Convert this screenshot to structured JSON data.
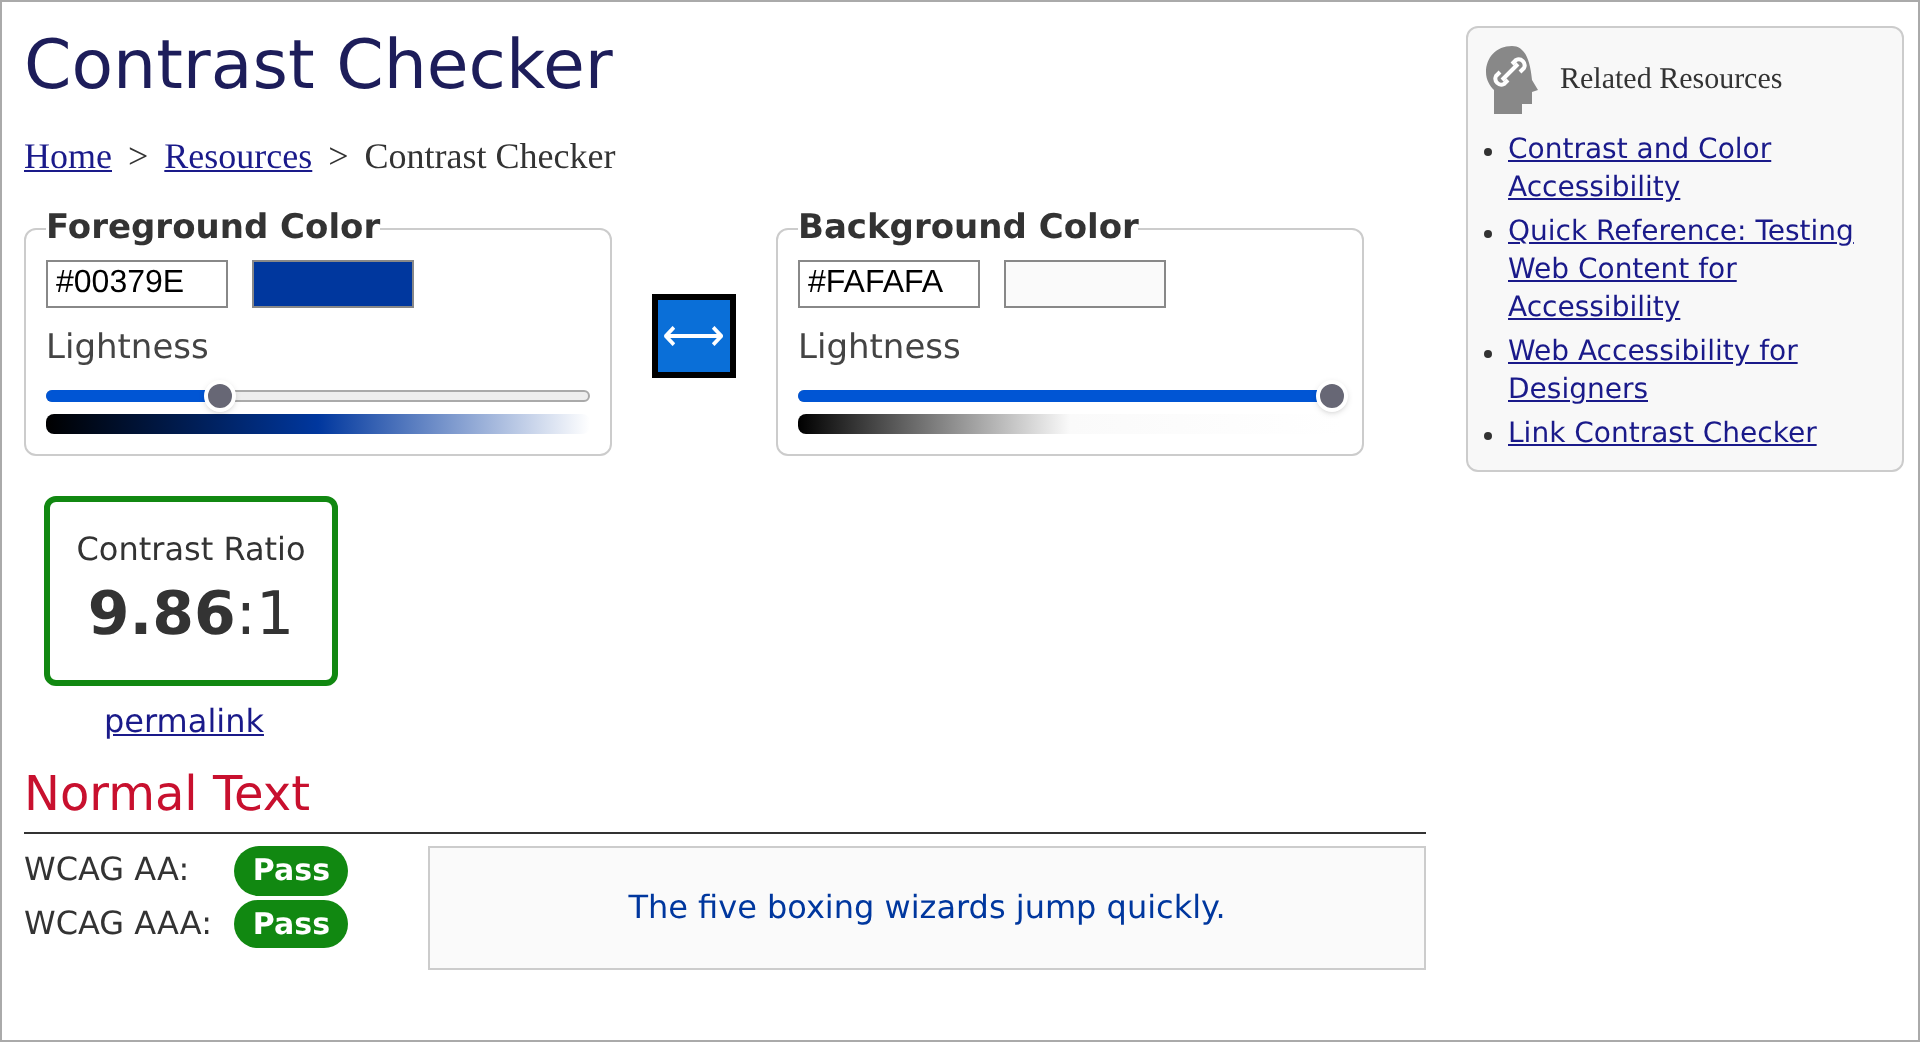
{
  "title": "Contrast Checker",
  "breadcrumb": {
    "separator": ">",
    "items": [
      {
        "label": "Home",
        "link": true
      },
      {
        "label": "Resources",
        "link": true
      },
      {
        "label": "Contrast Checker",
        "link": false
      }
    ]
  },
  "pickers": [
    {
      "legend": "Foreground Color",
      "value": "#00379E",
      "color": "#00379e",
      "slider_label": "Lightness",
      "level": 0.32
    },
    {
      "legend": "Background Color",
      "value": "#FAFAFA",
      "color": "#fafafa",
      "slider_label": "Lightness",
      "level": 0.98
    }
  ],
  "swap_button": "⟷",
  "ratio": {
    "label": "Contrast Ratio",
    "value": "**9.86**:1",
    "passed": true
  },
  "permalink": "permalink",
  "normal_text": {
    "heading": "Normal Text",
    "checks": [
      {
        "label": "WCAG AA:",
        "result": "Pass",
        "passed": true
      },
      {
        "label": "WCAG AAA:",
        "result": "Pass",
        "passed": true
      }
    ],
    "sample": "The five boxing wizards jump quickly."
  },
  "sidebar": {
    "title": "Related Resources",
    "links": [
      "Contrast and Color Accessibility",
      "Quick Reference: Testing Web Content for Accessibility",
      "Web Accessibility for Designers",
      "Link Contrast Checker"
    ]
  }
}
